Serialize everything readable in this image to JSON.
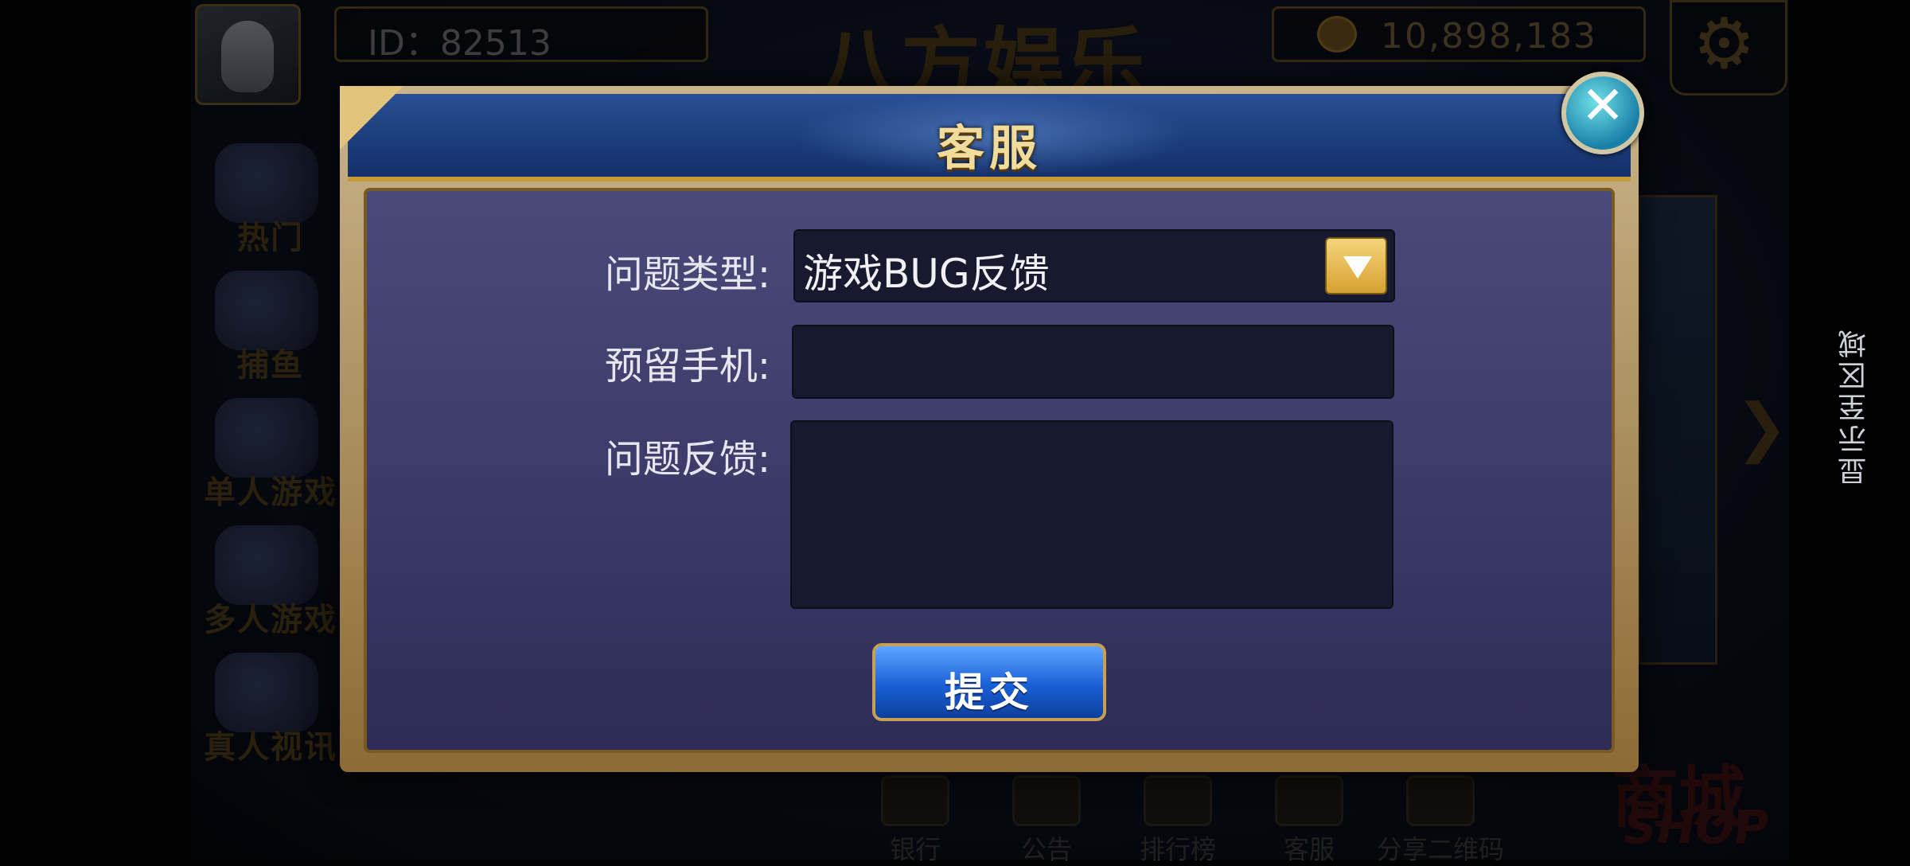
{
  "header": {
    "user_id": "ID：82513",
    "brand": "八方娱乐",
    "coins": "10,898,183"
  },
  "left_menu": [
    {
      "label": "热门"
    },
    {
      "label": "捕鱼"
    },
    {
      "label": "单人游戏"
    },
    {
      "label": "多人游戏"
    },
    {
      "label": "真人视讯"
    }
  ],
  "bottom_bar": [
    {
      "label": "银行"
    },
    {
      "label": "公告"
    },
    {
      "label": "排行榜"
    },
    {
      "label": "客服"
    },
    {
      "label": "分享二维码"
    }
  ],
  "shop": {
    "cn": "商城",
    "en": "SHOP"
  },
  "side_text": "显示至区域",
  "dialog": {
    "title": "客服",
    "close_symbol": "✕",
    "fields": {
      "type_label": "问题类型:",
      "type_value": "游戏BUG反馈",
      "phone_label": "预留手机:",
      "phone_value": "",
      "feedback_label": "问题反馈:",
      "feedback_value": ""
    },
    "submit_label": "提交"
  },
  "colors": {
    "accent_gold": "#c99a3c",
    "dialog_blue": "#1c3d7c",
    "body_purple": "#3a3866",
    "submit_blue": "#1a5fd6"
  }
}
